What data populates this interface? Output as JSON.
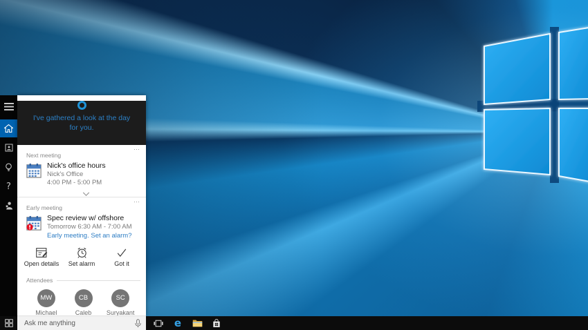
{
  "cortana": {
    "header": {
      "line1": "I've gathered a look at the day",
      "line2": "for you."
    },
    "rail": {
      "items": [
        {
          "name": "menu"
        },
        {
          "name": "home",
          "active": true
        },
        {
          "name": "notebook"
        },
        {
          "name": "reminders"
        },
        {
          "name": "help",
          "glyph": "?"
        },
        {
          "name": "feedback"
        }
      ]
    },
    "cards": [
      {
        "section": "Next meeting",
        "title": "Nick's office hours",
        "location": "Nick's Office",
        "time": "4:00 PM - 5:00 PM",
        "menu": "⋯"
      },
      {
        "section": "Early meeting",
        "title": "Spec review w/ offshore",
        "time": "Tomorrow 6:30 AM - 7:00 AM",
        "link": "Early meeting. Set an alarm?",
        "menu": "⋯"
      }
    ],
    "actions": [
      {
        "label": "Open details"
      },
      {
        "label": "Set alarm"
      },
      {
        "label": "Got it"
      }
    ],
    "attendees": {
      "label": "Attendees",
      "people": [
        {
          "initials": "MW",
          "name": "Michael"
        },
        {
          "initials": "CB",
          "name": "Caleb"
        },
        {
          "initials": "SC",
          "name": "Suryakant"
        }
      ]
    },
    "search": {
      "placeholder": "Ask me anything"
    }
  },
  "taskbar": {
    "edge_glyph": "e",
    "icons": [
      "start",
      "task-view",
      "edge",
      "file-explorer",
      "store"
    ]
  },
  "colors": {
    "accent": "#0078d7",
    "rail_active": "#0063b1",
    "cortana_text": "#2c80c6",
    "link": "#2d7dc4",
    "avatar": "#757575",
    "alert_red": "#e81123",
    "folder_yellow": "#f0c050",
    "edge_blue": "#35a2e6",
    "taskbar_bg": "#0c0c0c"
  }
}
